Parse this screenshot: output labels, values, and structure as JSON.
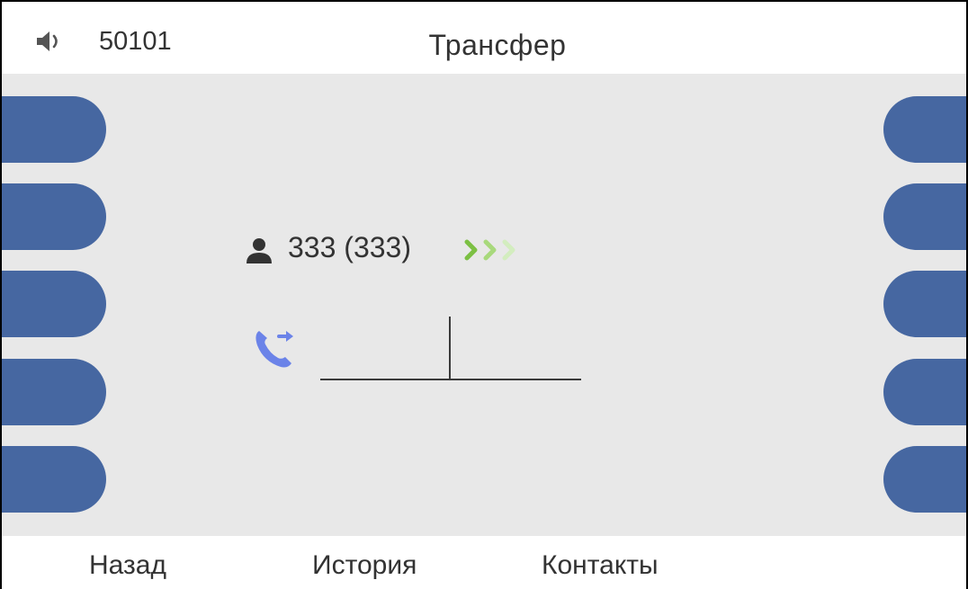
{
  "header": {
    "extension": "50101",
    "title": "Трансфер",
    "speaker_icon": "speaker-icon"
  },
  "call": {
    "contact": "333 (333)",
    "contact_icon": "person-icon",
    "status_icon": "ringing-arrows-icon",
    "transfer_icon": "call-transfer-icon",
    "input_value": ""
  },
  "side_keys": {
    "left_count": 5,
    "right_count": 5,
    "color": "#4667a1"
  },
  "softkeys": [
    {
      "label": "Назад"
    },
    {
      "label": "История"
    },
    {
      "label": "Контакты"
    }
  ],
  "colors": {
    "background": "#e8e8e8",
    "accent": "#4667a1",
    "transfer_icon": "#6b83e8",
    "arrows": [
      "#7cc043",
      "#a8d97c",
      "#d3edbf"
    ]
  }
}
